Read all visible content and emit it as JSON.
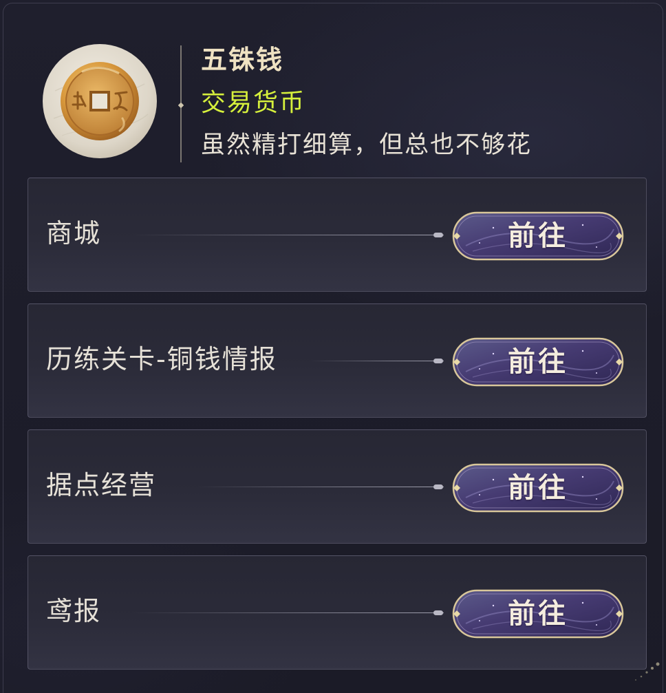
{
  "item": {
    "name": "五铢钱",
    "type": "交易货币",
    "description": "虽然精打细算，但总也不够花",
    "icon": "copper-coin-icon"
  },
  "sources": [
    {
      "label": "商城",
      "button": "前往"
    },
    {
      "label": "历练关卡-铜钱情报",
      "button": "前往"
    },
    {
      "label": "据点经营",
      "button": "前往"
    },
    {
      "label": "鸢报",
      "button": "前往"
    }
  ],
  "colors": {
    "type_accent": "#d6f03c",
    "title": "#efe2c2",
    "button_purple": "#4a3f78",
    "button_gold": "#d9c79a"
  }
}
